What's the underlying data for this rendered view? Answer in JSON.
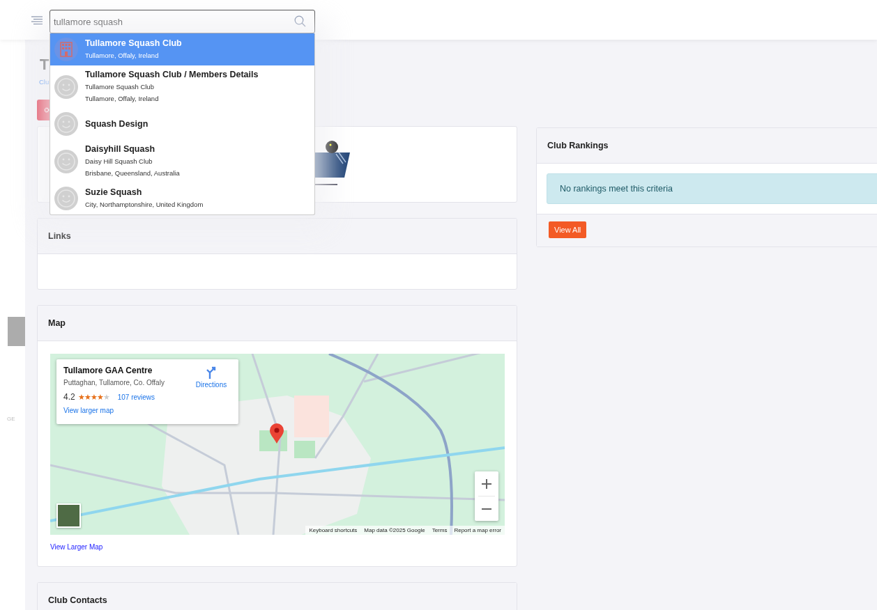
{
  "header": {
    "search": {
      "value": "tullamore squash"
    },
    "suggestions": [
      {
        "kind": "venue",
        "title": "Tullamore Squash Club",
        "lines": [
          "Tullamore, Offaly, Ireland"
        ],
        "selected": true
      },
      {
        "kind": "person",
        "title": "Tullamore Squash Club / Members Details",
        "lines": [
          "Tullamore Squash Club",
          "Tullamore, Offaly, Ireland"
        ],
        "selected": false
      },
      {
        "kind": "person",
        "title": "Squash Design",
        "selected": false
      },
      {
        "kind": "person",
        "title": "Daisyhill Squash",
        "lines": [
          "Daisy Hill Squash Club",
          "Brisbane, Queensland, Australia"
        ],
        "selected": false
      },
      {
        "kind": "person",
        "title": "Suzie Squash",
        "lines": [
          "City, Northamptonshire, United Kingdom"
        ],
        "selected": false
      }
    ]
  },
  "sidebar": {
    "label": "GE"
  },
  "page": {
    "title": "T",
    "breadcrumb": "Clu"
  },
  "rankings": {
    "title": "Club Rankings",
    "message": "No rankings meet this criteria",
    "button": "View All"
  },
  "links": {
    "title": "Links"
  },
  "map": {
    "title": "Map",
    "place": {
      "name": "Tullamore GAA Centre",
      "address": "Puttaghan, Tullamore, Co. Offaly",
      "directions": "Directions",
      "rating": "4.2",
      "stars": 4,
      "reviews": "107 reviews",
      "larger_map": "View larger map"
    },
    "attribution": [
      "Keyboard shortcuts",
      "Map data ©2025 Google",
      "Terms",
      "Report a map error"
    ],
    "link": "View Larger Map"
  },
  "contacts": {
    "title": "Club Contacts"
  }
}
